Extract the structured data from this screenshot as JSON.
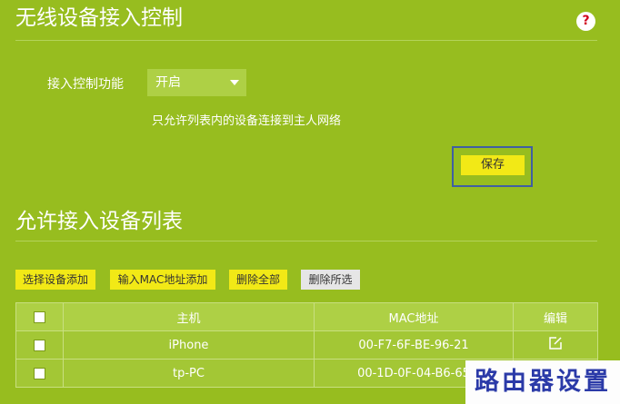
{
  "section1": {
    "title": "无线设备接入控制",
    "help_glyph": "?",
    "field_label": "接入控制功能",
    "select_value": "开启",
    "note": "只允许列表内的设备连接到主人网络",
    "save_label": "保存"
  },
  "section2": {
    "title": "允许接入设备列表",
    "buttons": {
      "select_add": "选择设备添加",
      "mac_add": "输入MAC地址添加",
      "delete_all": "删除全部",
      "delete_selected": "删除所选"
    },
    "table": {
      "headers": {
        "host": "主机",
        "mac": "MAC地址",
        "edit": "编辑"
      },
      "rows": [
        {
          "host": "iPhone",
          "mac": "00-F7-6F-BE-96-21"
        },
        {
          "host": "tp-PC",
          "mac": "00-1D-0F-04-B6-65"
        }
      ]
    }
  },
  "watermark": "路由器设置",
  "colors": {
    "background": "#97bd1f",
    "button_yellow": "#f2e916",
    "help_red": "#d0021b",
    "watermark_blue": "#2b3aa8"
  }
}
